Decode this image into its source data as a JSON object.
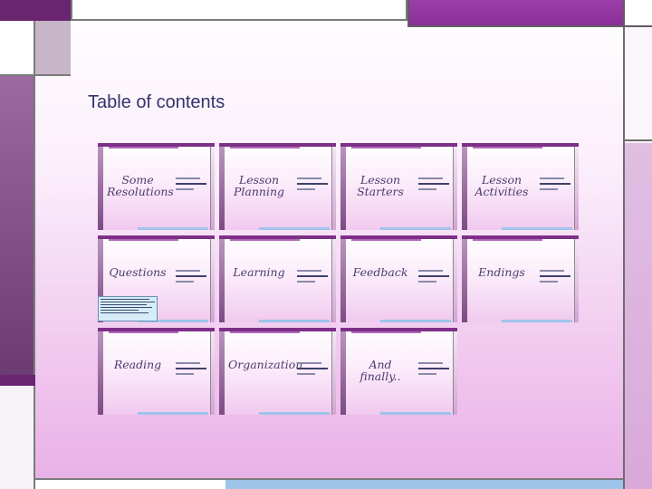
{
  "page": {
    "title": "Table of contents"
  },
  "slides": [
    {
      "label": "Some Resolutions",
      "line1": "Some",
      "line2": "Resolutions"
    },
    {
      "label": "Lesson Planning",
      "line1": "Lesson",
      "line2": "Planning"
    },
    {
      "label": "Lesson Starters",
      "line1": "Lesson",
      "line2": "Starters"
    },
    {
      "label": "Lesson Activities",
      "line1": "Lesson",
      "line2": "Activities"
    },
    {
      "label": "Questions",
      "line1": "Questions",
      "line2": ""
    },
    {
      "label": "Learning",
      "line1": "Learning",
      "line2": ""
    },
    {
      "label": "Feedback",
      "line1": "Feedback",
      "line2": ""
    },
    {
      "label": "Endings",
      "line1": "Endings",
      "line2": ""
    },
    {
      "label": "Reading",
      "line1": "Reading",
      "line2": ""
    },
    {
      "label": "Organization",
      "line1": "Organization",
      "line2": ""
    },
    {
      "label": "And finally..",
      "line1": "And",
      "line2": "finally.."
    }
  ],
  "colors": {
    "accent_purple": "#8a2f98",
    "dark_purple": "#6b2570",
    "title_text": "#33336a",
    "bottom_blue": "#9ec4ea"
  }
}
